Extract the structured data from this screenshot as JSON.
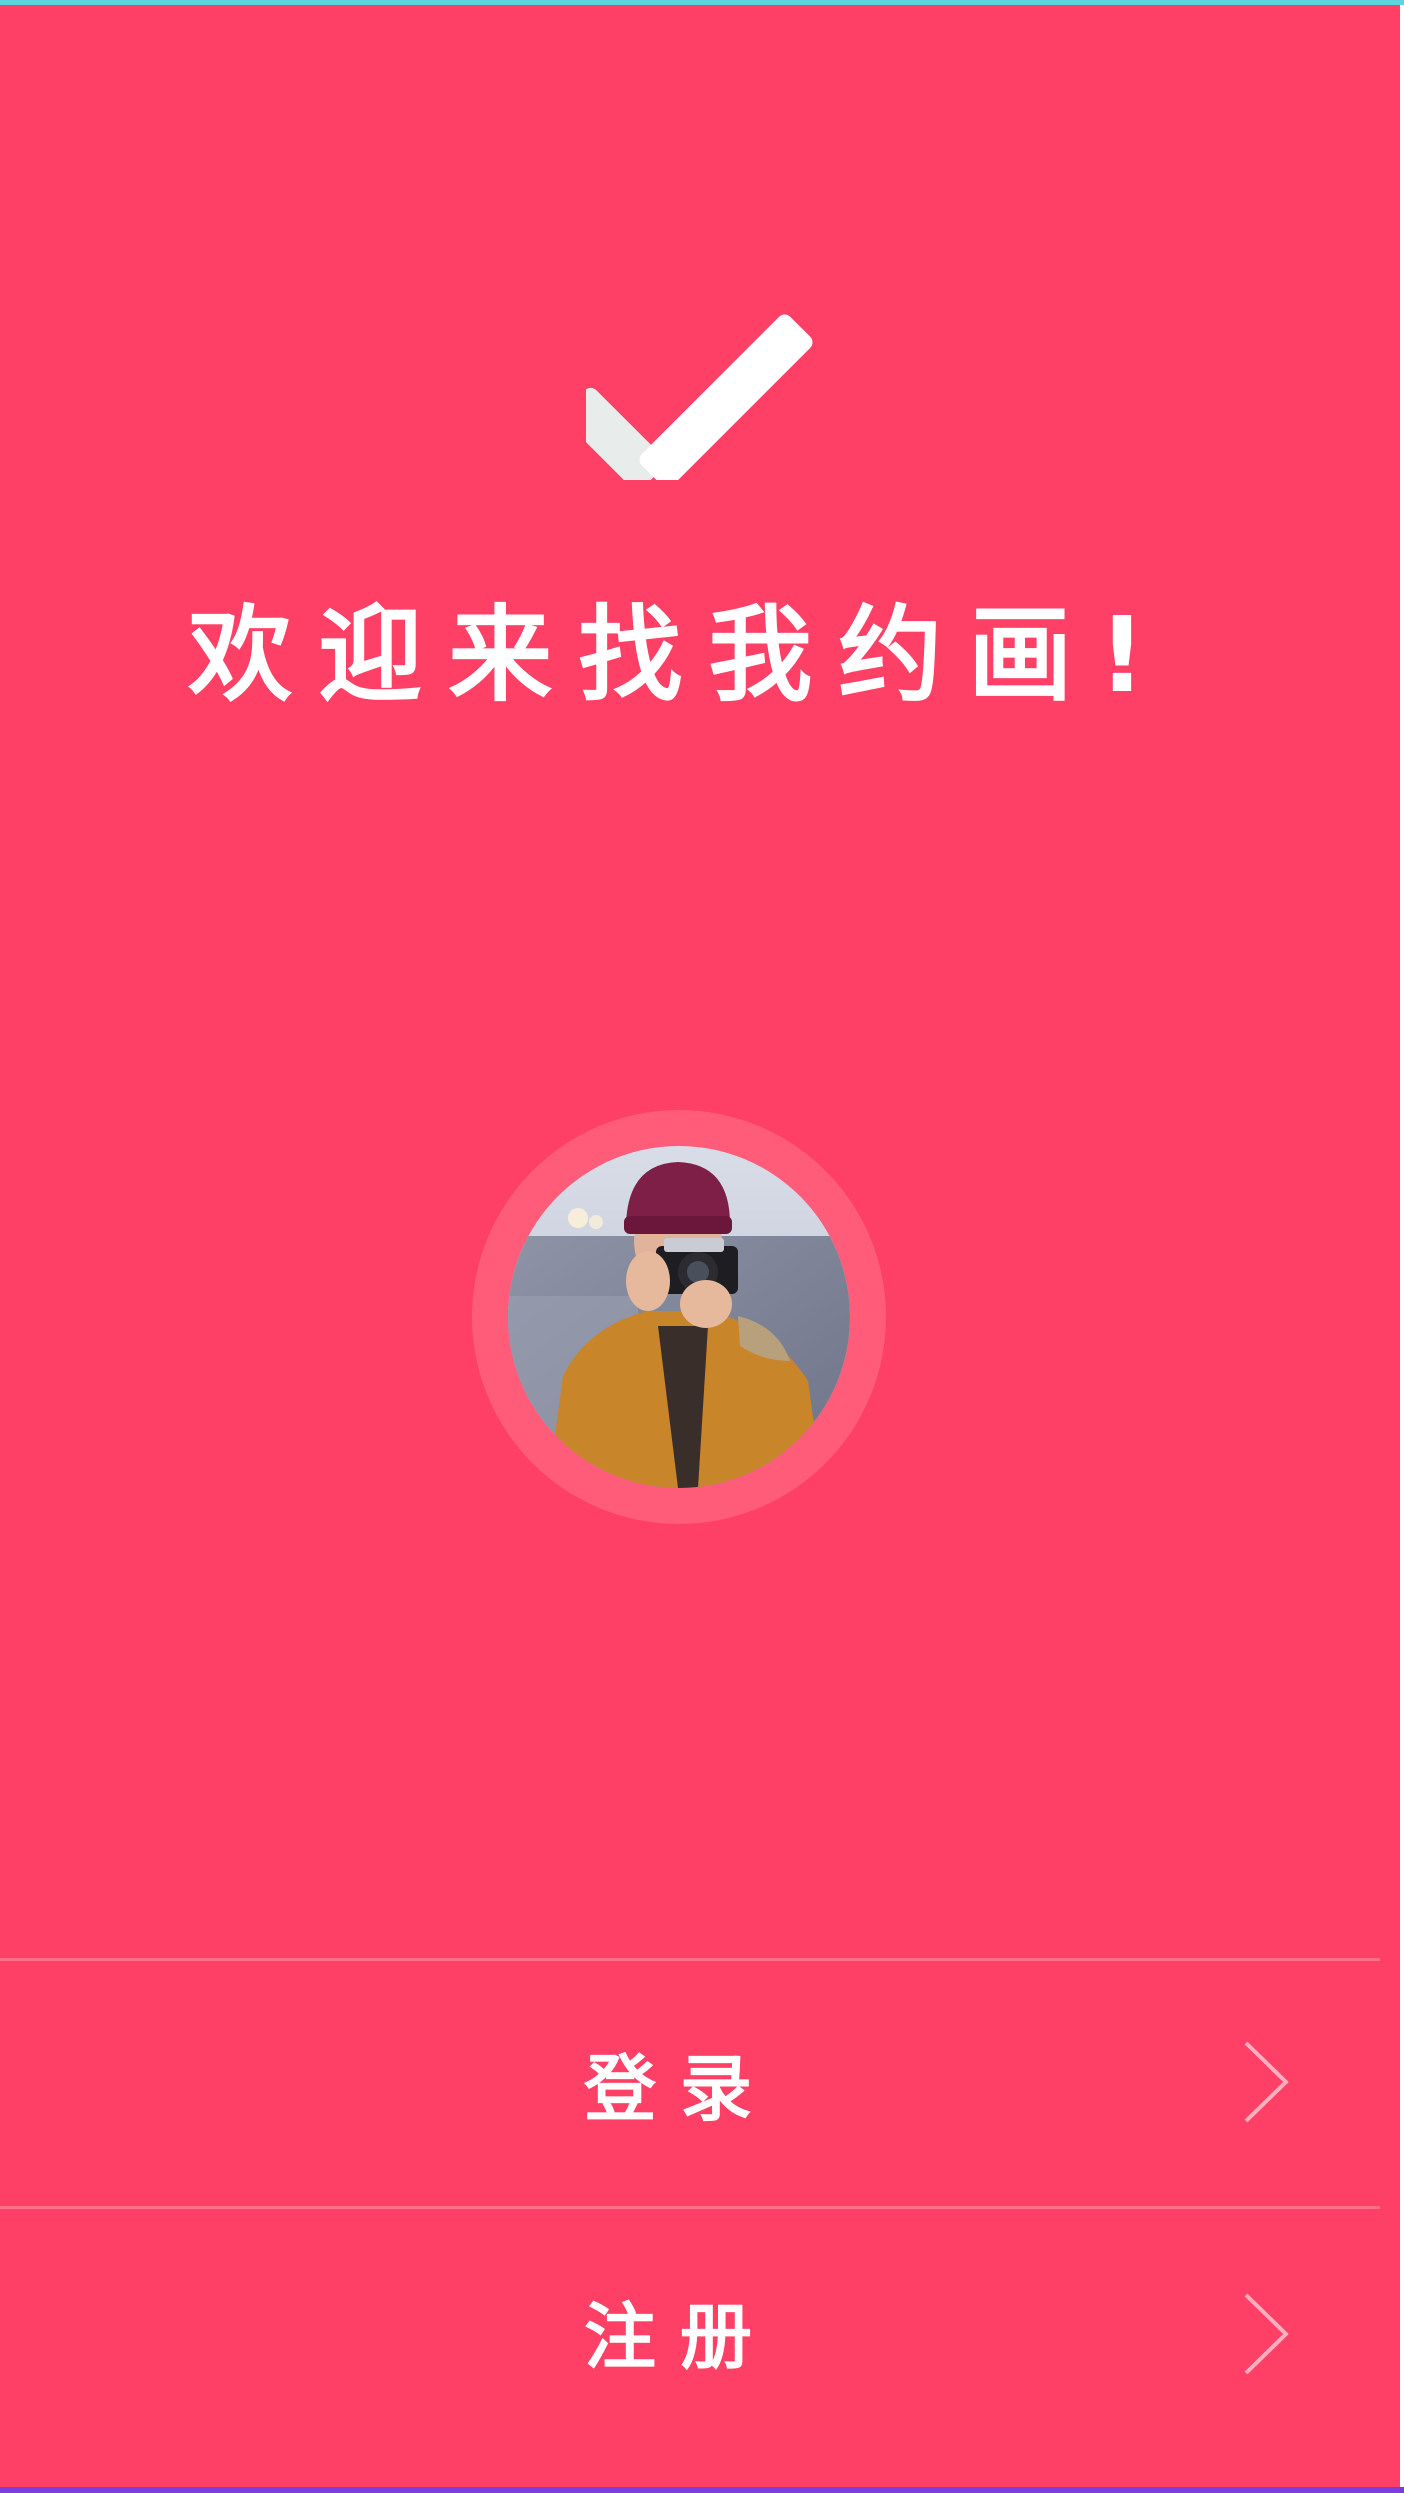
{
  "welcome": {
    "title": "欢迎来找我约画!"
  },
  "avatar": {
    "description_icon": "photographer-avatar"
  },
  "menu": {
    "login_label": "登录",
    "register_label": "注册"
  },
  "icons": {
    "logo": "checkmark-icon",
    "chevron": "chevron-right-icon"
  },
  "colors": {
    "background": "#FF4066",
    "top_strip": "#5FD3E0",
    "bottom_strip": "#7B3DDB",
    "text": "#FFFFFF",
    "avatar_ring": "#FF5C7A"
  }
}
